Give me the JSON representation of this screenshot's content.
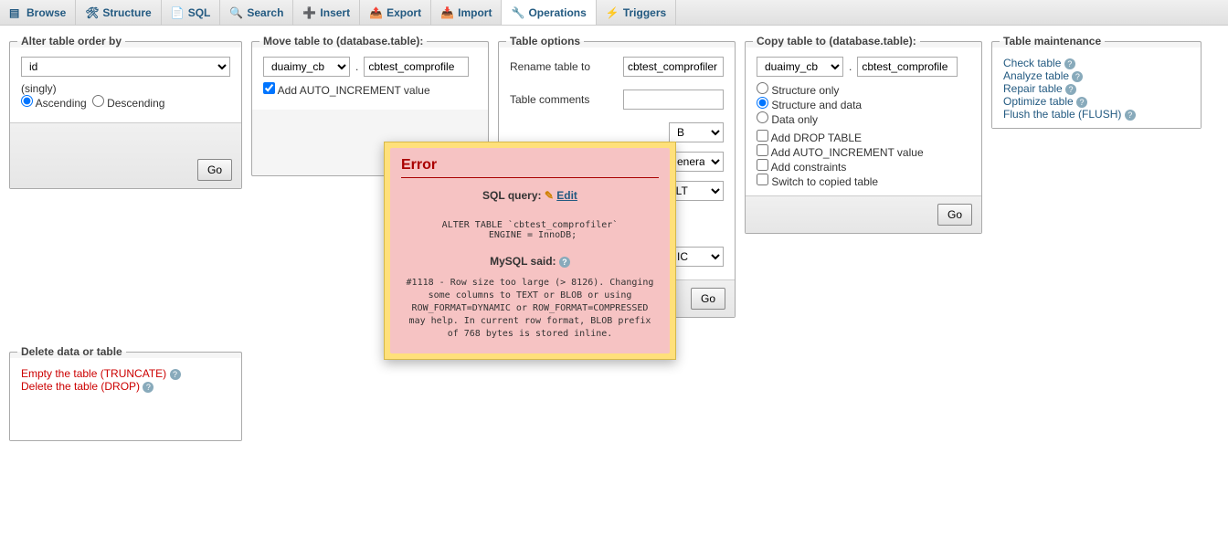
{
  "tabs": [
    {
      "label": "Browse"
    },
    {
      "label": "Structure"
    },
    {
      "label": "SQL"
    },
    {
      "label": "Search"
    },
    {
      "label": "Insert"
    },
    {
      "label": "Export"
    },
    {
      "label": "Import"
    },
    {
      "label": "Operations"
    },
    {
      "label": "Triggers"
    }
  ],
  "active_tab": 7,
  "alter": {
    "legend": "Alter table order by",
    "field": "id",
    "singly": "(singly)",
    "asc": "Ascending",
    "desc": "Descending",
    "go": "Go"
  },
  "move": {
    "legend": "Move table to (database.table):",
    "db": "duaimy_cb",
    "tbl": "cbtest_comprofile",
    "dot": ".",
    "auto": "Add AUTO_INCREMENT value"
  },
  "options": {
    "legend": "Table options",
    "rename": "Rename table to",
    "rename_val": "cbtest_comprofiler",
    "comments": "Table comments",
    "comments_val": "",
    "engine": "B",
    "collation": "enera",
    "pack": "ULT",
    "rowfmt": "MIC",
    "go": "Go"
  },
  "copy": {
    "legend": "Copy table to (database.table):",
    "db": "duaimy_cb",
    "tbl": "cbtest_comprofile",
    "dot": ".",
    "r_struct": "Structure only",
    "r_both": "Structure and data",
    "r_data": "Data only",
    "c_drop": "Add DROP TABLE",
    "c_auto": "Add AUTO_INCREMENT value",
    "c_const": "Add constraints",
    "c_switch": "Switch to copied table",
    "go": "Go"
  },
  "maint": {
    "legend": "Table maintenance",
    "check": "Check table",
    "analyze": "Analyze table",
    "repair": "Repair table",
    "optimize": "Optimize table",
    "flush": "Flush the table (FLUSH)"
  },
  "del": {
    "legend": "Delete data or table",
    "trunc": "Empty the table (TRUNCATE)",
    "drop": "Delete the table (DROP)"
  },
  "error": {
    "title": "Error",
    "sqlq_label": "SQL query:",
    "edit": "Edit",
    "sql": "ALTER TABLE `cbtest_comprofiler`\n ENGINE = InnoDB;",
    "said": "MySQL said:",
    "msg": "#1118 - Row size too large (> 8126). Changing some columns to TEXT or BLOB or using ROW_FORMAT=DYNAMIC or ROW_FORMAT=COMPRESSED may help. In current row format, BLOB prefix of 768 bytes is stored inline."
  }
}
